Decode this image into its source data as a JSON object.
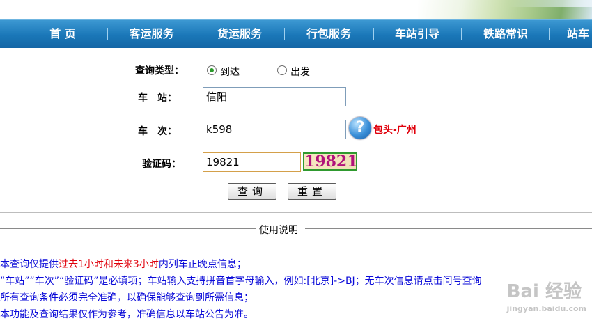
{
  "nav": {
    "items": [
      "首 页",
      "客运服务",
      "货运服务",
      "行包服务",
      "车站引导",
      "铁路常识",
      "站车"
    ]
  },
  "form": {
    "query_type_label": "查询类型：",
    "radio_arrive": "到达",
    "radio_depart": "出发",
    "selected": "到达",
    "station_label": "车　站：",
    "station_value": "信阳",
    "train_label": "车　次：",
    "train_value": "k598",
    "help_icon": "question-mark-icon",
    "route_hint": "包头-广州",
    "captcha_label": "验证码：",
    "captcha_value": "19821",
    "captcha_image_text": "19821",
    "query_button": "查询",
    "reset_button": "重置"
  },
  "instructions": {
    "title": "使用说明",
    "line1_a": "本查询仅提供",
    "line1_red": "过去1小时和未来3小时",
    "line1_b": "内列车正晚点信息；",
    "line2": "“车站”“车次”“验证码”是必填项；车站输入支持拼音首字母输入，例如:[北京]->BJ；无车次信息请点击问号查询",
    "line3": "所有查询条件必须完全准确，以确保能够查询到所需信息；",
    "line4": "本功能及查询结果仅作为参考，准确信息以车站公告为准。"
  },
  "watermark": {
    "text": "Bai 经验",
    "url": "jingyan.baidu.com"
  },
  "colors": {
    "nav": "#1a77b8",
    "route": "#e0000b",
    "instructions": "#0a0ad8",
    "captcha": "#b0117a"
  }
}
